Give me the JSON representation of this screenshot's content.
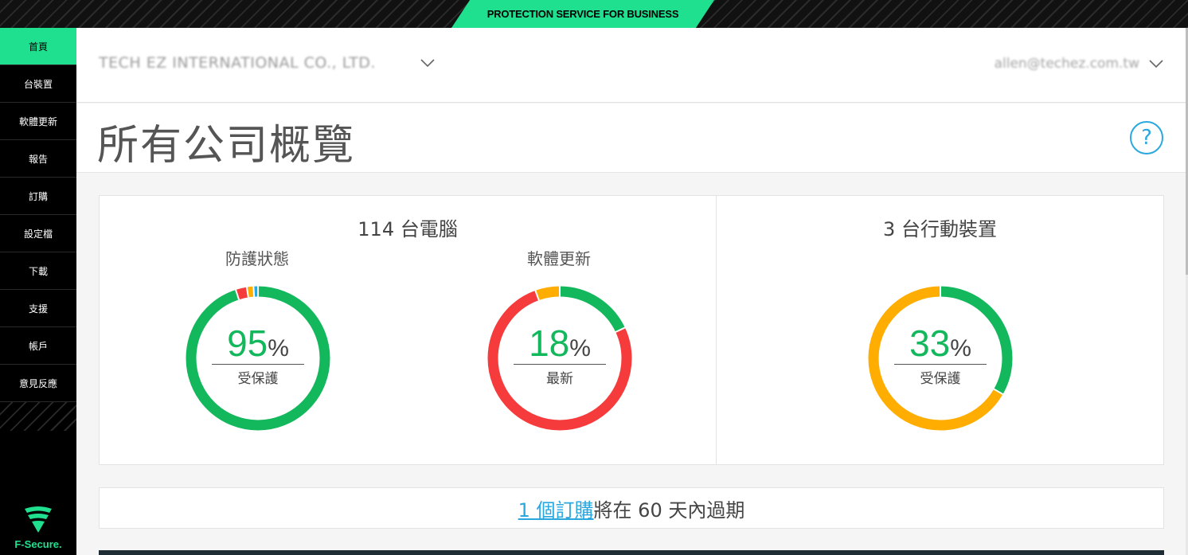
{
  "banner": {
    "text": "PROTECTION SERVICE FOR BUSINESS"
  },
  "sidebar": {
    "items": [
      {
        "label": "首頁"
      },
      {
        "label": "台裝置"
      },
      {
        "label": "軟體更新"
      },
      {
        "label": "報告"
      },
      {
        "label": "訂購"
      },
      {
        "label": "設定檔"
      },
      {
        "label": "下載"
      },
      {
        "label": "支援"
      },
      {
        "label": "帳戶"
      },
      {
        "label": "意見反應"
      }
    ],
    "logo_text": "F-Secure."
  },
  "header": {
    "company": "TECH EZ INTERNATIONAL CO., LTD.",
    "user": "allen@techez.com.tw"
  },
  "page": {
    "title": "所有公司概覽"
  },
  "computers": {
    "title": "114 台電腦",
    "protection": {
      "title": "防護狀態",
      "value": "95",
      "unit": "%",
      "label": "受保護"
    },
    "updates": {
      "title": "軟體更新",
      "value": "18",
      "unit": "%",
      "label": "最新"
    }
  },
  "mobile": {
    "title": "3 台行動裝置",
    "protection": {
      "value": "33",
      "unit": "%",
      "label": "受保護"
    }
  },
  "colors": {
    "green": "#14b85c",
    "red": "#f53b3b",
    "orange": "#ffad00",
    "blue": "#29a8e0",
    "accent": "#1fe08f"
  },
  "donuts": {
    "protection": [
      {
        "color": "#14b85c",
        "fraction": 0.95
      },
      {
        "color": "#f53b3b",
        "fraction": 0.025
      },
      {
        "color": "#ffad00",
        "fraction": 0.015
      },
      {
        "color": "#29a8e0",
        "fraction": 0.01
      }
    ],
    "updates": [
      {
        "color": "#14b85c",
        "fraction": 0.18
      },
      {
        "color": "#f53b3b",
        "fraction": 0.765
      },
      {
        "color": "#ffad00",
        "fraction": 0.055
      }
    ],
    "mobile": [
      {
        "color": "#14b85c",
        "fraction": 0.333
      },
      {
        "color": "#ffad00",
        "fraction": 0.667
      }
    ]
  },
  "subscription": {
    "link": "1 個訂購",
    "text": "將在 60 天內過期"
  }
}
